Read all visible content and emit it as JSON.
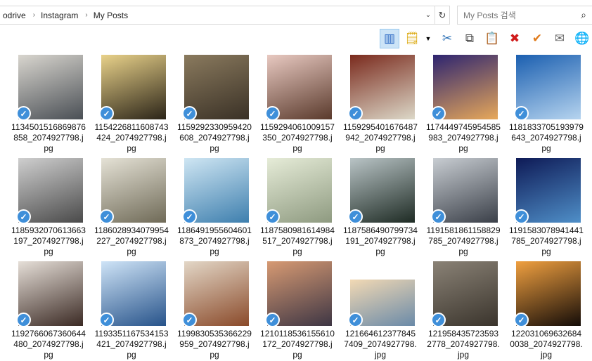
{
  "address": {
    "crumbs": [
      "odrive",
      "Instagram",
      "My Posts"
    ],
    "separator": "›",
    "dropdown_icon": "chevron-down-icon",
    "refresh_icon": "refresh-icon"
  },
  "search": {
    "placeholder": "My Posts 검색",
    "value": ""
  },
  "toolbar": {
    "buttons": [
      {
        "name": "preview-pane-icon",
        "glyph": "▥",
        "color": "#1f5fbf",
        "active": true
      },
      {
        "name": "new-note-icon",
        "glyph": "🗒",
        "color": "#d9a400"
      },
      {
        "name": "cut-icon",
        "glyph": "✂",
        "color": "#2a6fb5"
      },
      {
        "name": "copy-icon",
        "glyph": "⧉",
        "color": "#444"
      },
      {
        "name": "paste-icon",
        "glyph": "📋",
        "color": "#8a6d3b"
      },
      {
        "name": "delete-icon",
        "glyph": "✖",
        "color": "#d01a1a"
      },
      {
        "name": "check-icon",
        "glyph": "✔",
        "color": "#e07a1a"
      },
      {
        "name": "mail-icon",
        "glyph": "✉",
        "color": "#666"
      },
      {
        "name": "globe-icon",
        "glyph": "🌐",
        "color": "#2a6fb5"
      }
    ]
  },
  "files": [
    {
      "name": "1134501516869876858_2074927798.jpg",
      "label": "1134501516869\n876858_207492\n7798.jpg",
      "colors": [
        "#d9d6cf",
        "#4a4f55"
      ]
    },
    {
      "name": "1154226811608743424_2074927798.jpg",
      "label": "1154226811608\n743424_207492\n7798.jpg",
      "colors": [
        "#e9d28a",
        "#2b2418"
      ]
    },
    {
      "name": "1159292330959420608_2074927798.jpg",
      "label": "1159292330959\n420608_207492\n7798.jpg",
      "colors": [
        "#8a7a5e",
        "#3a3126"
      ]
    },
    {
      "name": "1159294061009157350_2074927798.jpg",
      "label": "1159294061009\n157350_207492\n7798.jpg",
      "colors": [
        "#e8c9c1",
        "#5a3a2c"
      ]
    },
    {
      "name": "1159295401676487942_2074927798.jpg",
      "label": "1159295401676\n487942_207492\n7798.jpg",
      "colors": [
        "#7a2a1d",
        "#dcd8c8"
      ]
    },
    {
      "name": "1174449745954585983_2074927798.jpg",
      "label": "1174449745954\n585983_207492\n7798.jpg",
      "colors": [
        "#2d2470",
        "#e7a85a"
      ]
    },
    {
      "name": "1181833705193979643_2074927798.jpg",
      "label": "1181833705193\n979643_207492\n7798.jpg",
      "colors": [
        "#1b5fb0",
        "#b6d4ef"
      ]
    },
    {
      "name": "1185932070613663197_2074927798.jpg",
      "label": "1185932070613\n663197_207492\n7798.jpg",
      "colors": [
        "#cfcfcf",
        "#4a4a4a"
      ]
    },
    {
      "name": "1186028934079954227_2074927798.jpg",
      "label": "1186028934079\n954227_207492\n7798.jpg",
      "colors": [
        "#e5e2d6",
        "#6f6a57"
      ]
    },
    {
      "name": "1186491955604601873_2074927798.jpg",
      "label": "1186491955604\n601873_207492\n7798.jpg",
      "colors": [
        "#cfe6f3",
        "#3e7fae"
      ]
    },
    {
      "name": "1187580981614984517_2074927798.jpg",
      "label": "1187580981614\n984517_207492\n7798.jpg",
      "colors": [
        "#e6ecd8",
        "#8e9a80"
      ]
    },
    {
      "name": "1187586490799734191_2074927798.jpg",
      "label": "1187586490799\n734191_207492\n7798.jpg",
      "colors": [
        "#b9c4c6",
        "#1e2b24"
      ]
    },
    {
      "name": "1191581861158829785_2074927798.jpg",
      "label": "1191581861158\n829785_207492\n7798.jpg",
      "colors": [
        "#c8cdd2",
        "#3a3f48"
      ]
    },
    {
      "name": "1191583078941441785_2074927798.jpg",
      "label": "1191583078941\n441785_207492\n7798.jpg",
      "colors": [
        "#0e1a56",
        "#4f8fc8"
      ]
    },
    {
      "name": "1192766067360644480_2074927798.jpg",
      "label": "1192766067360\n644480_207492\n7798.jpg",
      "colors": [
        "#e6dfd8",
        "#3b2a24"
      ]
    },
    {
      "name": "1193351167534153421_2074927798.jpg",
      "label": "1193351167534\n153421_207492\n7798.jpg",
      "colors": [
        "#cfe4f7",
        "#27538a"
      ]
    },
    {
      "name": "1199830535366229959_2074927798.jpg",
      "label": "1199830535366\n229959_207492\n7798.jpg",
      "colors": [
        "#e3d7c7",
        "#8a4a2a"
      ]
    },
    {
      "name": "1210118536155610172_2074927798.jpg",
      "label": "1210118536155\n610172_207492\n7798.jpg",
      "colors": [
        "#d79a73",
        "#3e3644"
      ]
    },
    {
      "name": "1216646123778457409_2074927798.jpg",
      "label": "1216646123778\n457409_207492\n7798.jpg",
      "colors": [
        "#f2d9b4",
        "#6a8aa8"
      ]
    },
    {
      "name": "1219584357235932778_2074927798.jpg",
      "label": "1219584357235\n932778_207492\n7798.jpg",
      "colors": [
        "#8a8276",
        "#3a342c"
      ]
    },
    {
      "name": "1220310696326840038_2074927798.jpg",
      "label": "1220310696326\n840038_207492\n7798.jpg",
      "colors": [
        "#f0a040",
        "#140c08"
      ]
    }
  ],
  "check_icon": "checkmark-icon",
  "colors": {
    "check_blue": "#3f8fd9",
    "selected_button": "#cce4f7"
  }
}
